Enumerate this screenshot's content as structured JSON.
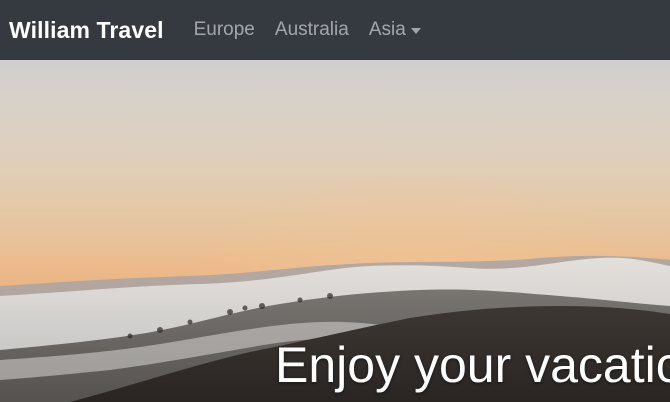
{
  "navbar": {
    "brand": "William Travel",
    "links": [
      {
        "label": "Europe"
      },
      {
        "label": "Australia"
      },
      {
        "label": "Asia",
        "dropdown": true
      }
    ]
  },
  "hero": {
    "caption": "Enjoy your vacatic"
  },
  "colors": {
    "navbar_bg": "#343a40",
    "brand_text": "#ffffff",
    "link_text": "rgba(255,255,255,0.55)"
  }
}
